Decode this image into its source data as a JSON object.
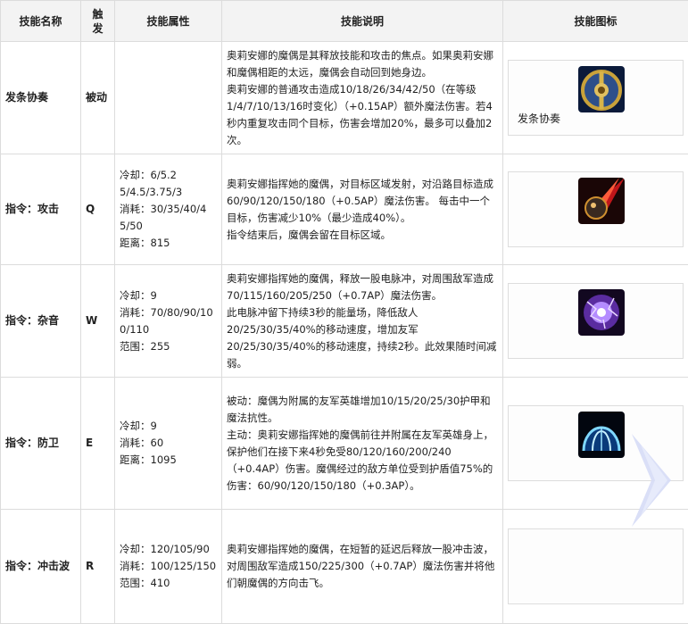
{
  "headers": {
    "name": "技能名称",
    "trigger": "触发",
    "attributes": "技能属性",
    "description": "技能说明",
    "icon": "技能图标"
  },
  "rows": [
    {
      "name": "发条协奏",
      "trigger": "被动",
      "attributes": [],
      "description": [
        "奥莉安娜的魔偶是其释放技能和攻击的焦点。如果奥莉安娜和魔偶相距的太远，魔偶会自动回到她身边。",
        "奥莉安娜的普通攻击造成10/18/26/34/42/50（在等级1/4/7/10/13/16时变化）（+0.15AP）额外魔法伤害。若4秒内重复攻击同个目标，伤害会增加20%，最多可以叠加2次。"
      ],
      "icon_label": "发条协奏",
      "icon_name": "gear-orb-icon"
    },
    {
      "name": "指令：攻击",
      "trigger": "Q",
      "attributes": [
        "冷却：6/5.2",
        "5/4.5/3.75/3",
        "消耗：30/35/40/4",
        "5/50",
        "距离：815"
      ],
      "description": [
        "奥莉安娜指挥她的魔偶，对目标区域发射，对沿路目标造成60/90/120/150/180（+0.5AP）魔法伤害。 每击中一个目标，伤害减少10%（最少造成40%）。",
        "指令结束后，魔偶会留在目标区域。"
      ],
      "icon_label": "",
      "icon_name": "fireball-icon"
    },
    {
      "name": "指令：杂音",
      "trigger": "W",
      "attributes": [
        "冷却：9",
        "消耗：70/80/90/10",
        "0/110",
        "范围：255"
      ],
      "description": [
        "奥莉安娜指挥她的魔偶，释放一股电脉冲，对周围敌军造成70/115/160/205/250（+0.7AP）魔法伤害。",
        "此电脉冲留下持续3秒的能量场，降低敌人20/25/30/35/40%的移动速度，增加友军20/25/30/35/40%的移动速度，持续2秒。此效果随时间减弱。"
      ],
      "icon_label": "",
      "icon_name": "electric-pulse-icon"
    },
    {
      "name": "指令：防卫",
      "trigger": "E",
      "attributes": [
        "冷却：9",
        "消耗：60",
        "距离：1095"
      ],
      "description": [
        "被动：魔偶为附属的友军英雄增加10/15/20/25/30护甲和魔法抗性。",
        "主动：奥莉安娜指挥她的魔偶前往并附属在友军英雄身上，保护他们在接下来4秒免受80/120/160/200/240（+0.4AP）伤害。魔偶经过的敌方单位受到护盾值75%的伤害：60/90/120/150/180（+0.3AP）。"
      ],
      "icon_label": "",
      "icon_name": "shield-dome-icon"
    },
    {
      "name": "指令：冲击波",
      "trigger": "R",
      "attributes": [
        "冷却：120/105/90",
        "消耗：100/125/150",
        "范围：410"
      ],
      "description": [
        "奥莉安娜指挥她的魔偶，在短暂的延迟后释放一股冲击波，对周围敌军造成150/225/300（+0.7AP）魔法伤害并将他们朝魔偶的方向击飞。"
      ],
      "icon_label": "",
      "icon_name": "shockwave-icon"
    }
  ]
}
